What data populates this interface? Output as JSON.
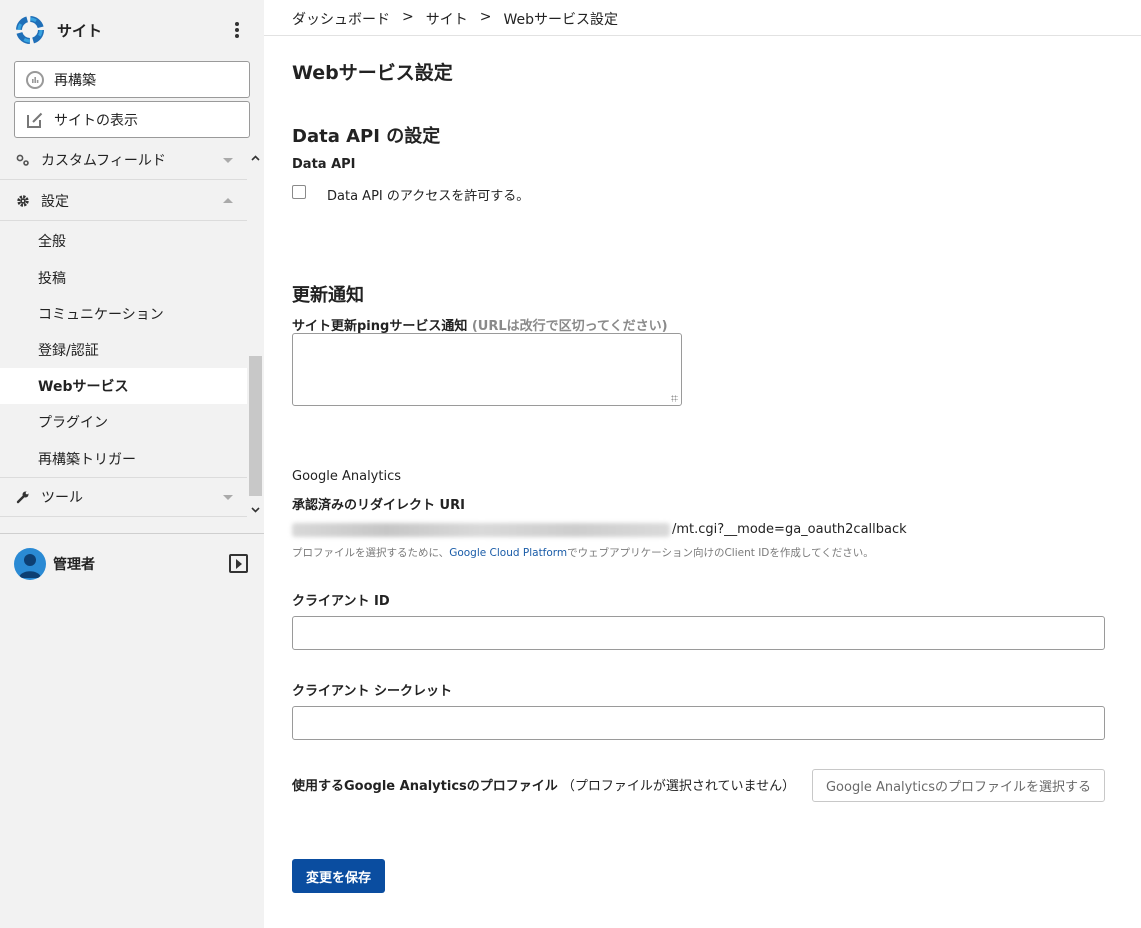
{
  "sidebar": {
    "site_name": "サイト",
    "rebuild_label": "再構築",
    "view_site_label": "サイトの表示",
    "menu": {
      "custom_fields": "カスタムフィールド",
      "settings": "設定",
      "children": [
        "全般",
        "投稿",
        "コミュニケーション",
        "登録/認証",
        "Webサービス",
        "プラグイン",
        "再構築トリガー"
      ],
      "active_child": "Webサービス",
      "tools": "ツール"
    },
    "user_name": "管理者"
  },
  "breadcrumb": [
    "ダッシュボード",
    "サイト",
    "Webサービス設定"
  ],
  "breadcrumb_sep": ">",
  "page_title": "Webサービス設定",
  "data_api": {
    "heading": "Data API の設定",
    "label": "Data API",
    "checkbox_label": "Data API のアクセスを許可する。",
    "checked": false
  },
  "update_ping": {
    "heading": "更新通知",
    "label": "サイト更新pingサービス通知",
    "hint": "(URLは改行で区切ってください)",
    "value": ""
  },
  "google_analytics": {
    "section_label": "Google Analytics",
    "redirect_label": "承認済みのリダイレクト URI",
    "redirect_uri_suffix": "/mt.cgi?__mode=ga_oauth2callback",
    "help_prefix": "プロファイルを選択するために、",
    "help_link": "Google Cloud Platform",
    "help_suffix": "でウェブアプリケーション向けのClient IDを作成してください。",
    "client_id_label": "クライアント ID",
    "client_id_value": "",
    "client_secret_label": "クライアント シークレット",
    "client_secret_value": "",
    "profile_label": "使用するGoogle Analyticsのプロファイル",
    "profile_status": "（プロファイルが選択されていません）",
    "profile_button": "Google Analyticsのプロファイルを選択する"
  },
  "save_button": "変更を保存",
  "colors": {
    "accent": "#0a4da0",
    "link": "#1a5ca8",
    "sidebar_bg": "#f2f2f2"
  }
}
